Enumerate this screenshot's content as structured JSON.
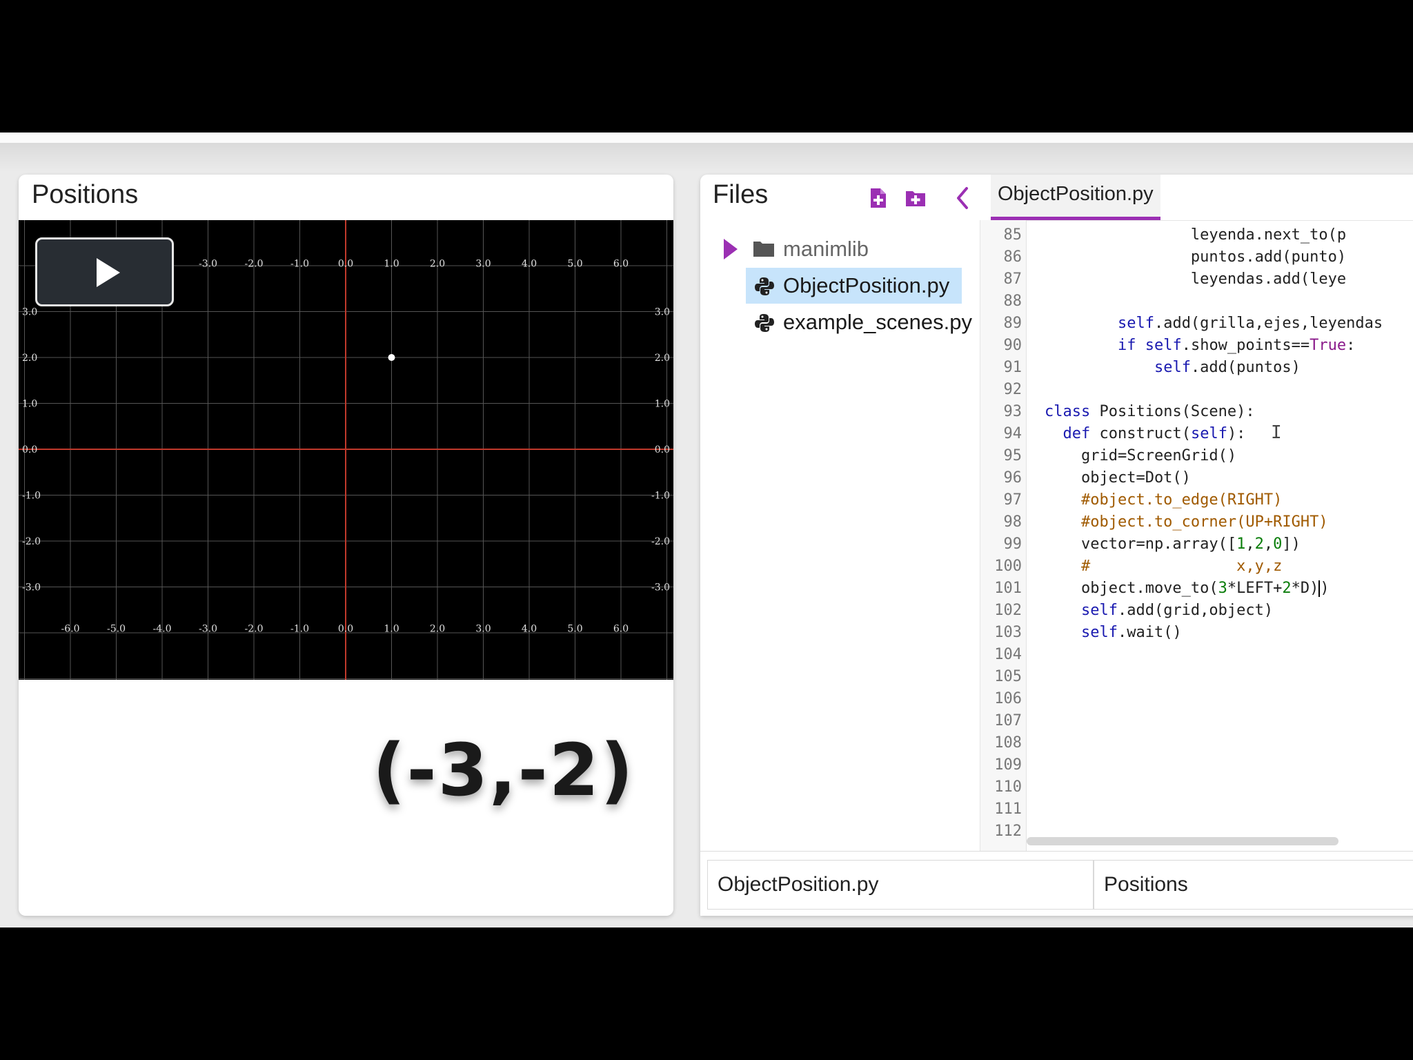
{
  "scene": {
    "title": "Positions",
    "overlay_coordinate": "(-3,-2)",
    "grid": {
      "x_ticks": [
        "-6.0",
        "-5.0",
        "-4.0",
        "-3.0",
        "-2.0",
        "-1.0",
        "0.0",
        "1.0",
        "2.0",
        "3.0",
        "4.0",
        "5.0",
        "6.0"
      ],
      "x_values": [
        -6,
        -5,
        -4,
        -3,
        -2,
        -1,
        0,
        1,
        2,
        3,
        4,
        5,
        6
      ],
      "y_ticks": [
        "3.0",
        "2.0",
        "1.0",
        "0.0",
        "-1.0",
        "-2.0",
        "-3.0"
      ],
      "y_values": [
        3,
        2,
        1,
        0,
        -1,
        -2,
        -3
      ],
      "dot": {
        "x": 1,
        "y": 2
      },
      "axis_color": "#c0392b",
      "grid_color": "#555555"
    },
    "play_button": "play-icon"
  },
  "files": {
    "title": "Files",
    "new_file_icon": "new-file-icon",
    "new_folder_icon": "new-folder-icon",
    "collapse_icon": "chevron-left-icon",
    "items": [
      {
        "label": "manimlib",
        "type": "folder"
      },
      {
        "label": "ObjectPosition.py",
        "type": "python"
      },
      {
        "label": "example_scenes.py",
        "type": "python"
      }
    ]
  },
  "tab": {
    "label": "ObjectPosition.py"
  },
  "editor": {
    "line_numbers": [
      "85",
      "86",
      "87",
      "88",
      "89",
      "90",
      "91",
      "92",
      "93",
      "94",
      "95",
      "96",
      "97",
      "98",
      "99",
      "100",
      "101",
      "102",
      "103",
      "104",
      "105",
      "106",
      "107",
      "108",
      "109",
      "110",
      "111",
      "112"
    ],
    "lines": [
      "                leyenda.next_to(p",
      "                puntos.add(punto)",
      "                leyendas.add(leye",
      "",
      "        self.add(grilla,ejes,leyendas",
      "        if self.show_points==True:",
      "            self.add(puntos)",
      "",
      "class Positions(Scene):",
      "  def construct(self):",
      "    grid=ScreenGrid()",
      "    object=Dot()",
      "    #object.to_edge(RIGHT)",
      "    #object.to_corner(UP+RIGHT)",
      "    vector=np.array([1,2,0])",
      "    #                x,y,z",
      "    object.move_to(3*LEFT+2*D)",
      "    self.add(grid,object)",
      "    self.wait()",
      "",
      "",
      "",
      "",
      "",
      "",
      "",
      "",
      ""
    ]
  },
  "status": {
    "file": "ObjectPosition.py",
    "scene": "Positions"
  },
  "colors": {
    "accent": "#9b2fb3",
    "selection": "#c7e4fb"
  }
}
